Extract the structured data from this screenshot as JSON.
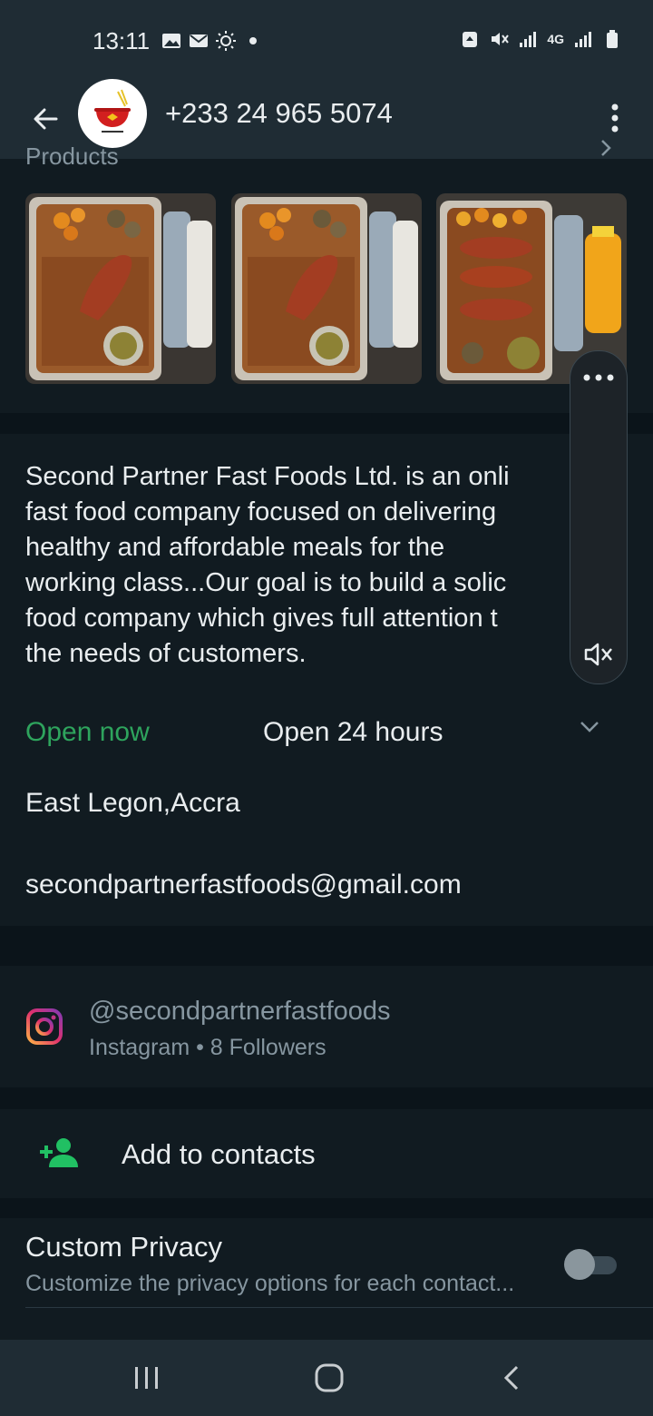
{
  "status_bar": {
    "time": "13:11",
    "network": "4G"
  },
  "app_bar": {
    "contact_number": "+233 24 965 5074"
  },
  "products": {
    "header": "Products"
  },
  "about": {
    "description": "Second Partner Fast Foods Ltd. is an onli\nfast food company focused on delivering\nhealthy and affordable meals for the\nworking class...Our goal is to build a solic\nfood company which gives full attention t\nthe needs of customers.",
    "open_status": "Open now",
    "hours": "Open 24 hours",
    "address": "East Legon,Accra",
    "email": "secondpartnerfastfoods@gmail.com"
  },
  "instagram": {
    "handle": "@secondpartnerfastfoods",
    "subtitle": "Instagram • 8 Followers"
  },
  "add_contact": {
    "label": "Add to contacts"
  },
  "privacy": {
    "title": "Custom Privacy",
    "subtitle": "Customize the privacy options for each contact..."
  },
  "colors": {
    "accent_green": "#2ea45d",
    "add_icon_teal": "#21c063",
    "background": "#0b141a",
    "surface": "#111b21"
  }
}
